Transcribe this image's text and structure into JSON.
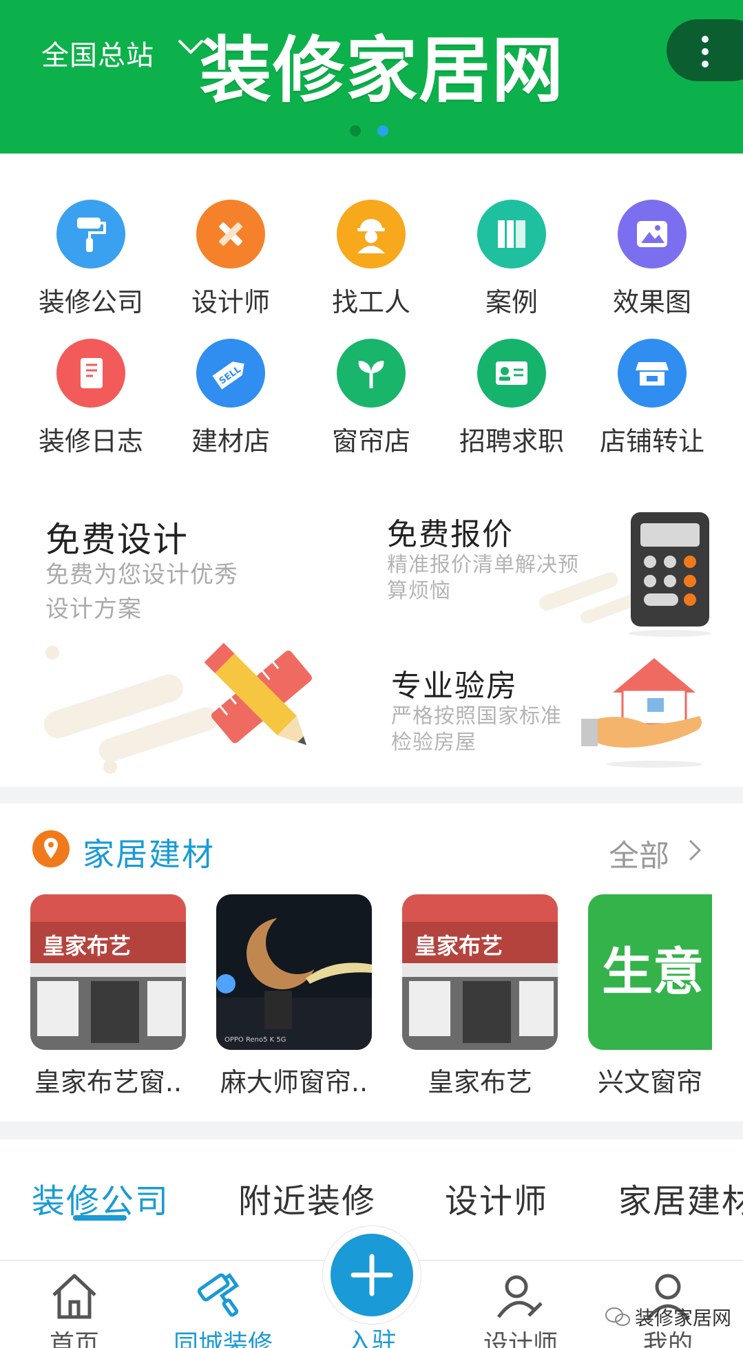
{
  "header": {
    "city": "全国总站",
    "brand": "装修家居网",
    "carousel_dots": 2,
    "carousel_active": 2,
    "colors": {
      "banner": "#0db14b",
      "accent": "#1a9ad6"
    }
  },
  "categories": [
    {
      "label": "装修公司",
      "icon": "paint-roller-icon",
      "color": "#3aa0f0"
    },
    {
      "label": "设计师",
      "icon": "pencil-ruler-icon",
      "color": "#f5822a"
    },
    {
      "label": "找工人",
      "icon": "worker-icon",
      "color": "#f7a81b"
    },
    {
      "label": "案例",
      "icon": "books-icon",
      "color": "#1fc0a0"
    },
    {
      "label": "效果图",
      "icon": "image-icon",
      "color": "#7b6ff0"
    },
    {
      "label": "装修日志",
      "icon": "notebook-icon",
      "color": "#f35a5a"
    },
    {
      "label": "建材店",
      "icon": "sell-tag-icon",
      "color": "#2f8ef0"
    },
    {
      "label": "窗帘店",
      "icon": "sprout-icon",
      "color": "#18b56a"
    },
    {
      "label": "招聘求职",
      "icon": "id-card-icon",
      "color": "#16b36c"
    },
    {
      "label": "店铺转让",
      "icon": "store-icon",
      "color": "#2f8ef0"
    }
  ],
  "promos": {
    "design": {
      "title": "免费设计",
      "desc_line1": "免费为您设计优秀",
      "desc_line2": "设计方案"
    },
    "quote": {
      "title": "免费报价",
      "desc_line1": "精准报价清单解决预",
      "desc_line2": "算烦恼"
    },
    "inspect": {
      "title": "专业验房",
      "desc_line1": "严格按照国家标准",
      "desc_line2": "检验房屋"
    }
  },
  "section": {
    "title": "家居建材",
    "more": "全部",
    "shops": [
      {
        "name": "皇家布艺窗..",
        "sign": "皇家布艺"
      },
      {
        "name": "麻大师窗帘..",
        "photo_text": "OPPO Reno5 K 5G"
      },
      {
        "name": "皇家布艺",
        "sign": "皇家布艺"
      },
      {
        "name": "兴文窗帘",
        "sign": "生意"
      }
    ]
  },
  "tabs": [
    "装修公司",
    "附近装修",
    "设计师",
    "家居建材"
  ],
  "bottom_nav": {
    "home": "首页",
    "local": "同城装修",
    "join": "入驻",
    "designer": "设计师",
    "mine": "我的"
  },
  "watermark": "装修家居网"
}
